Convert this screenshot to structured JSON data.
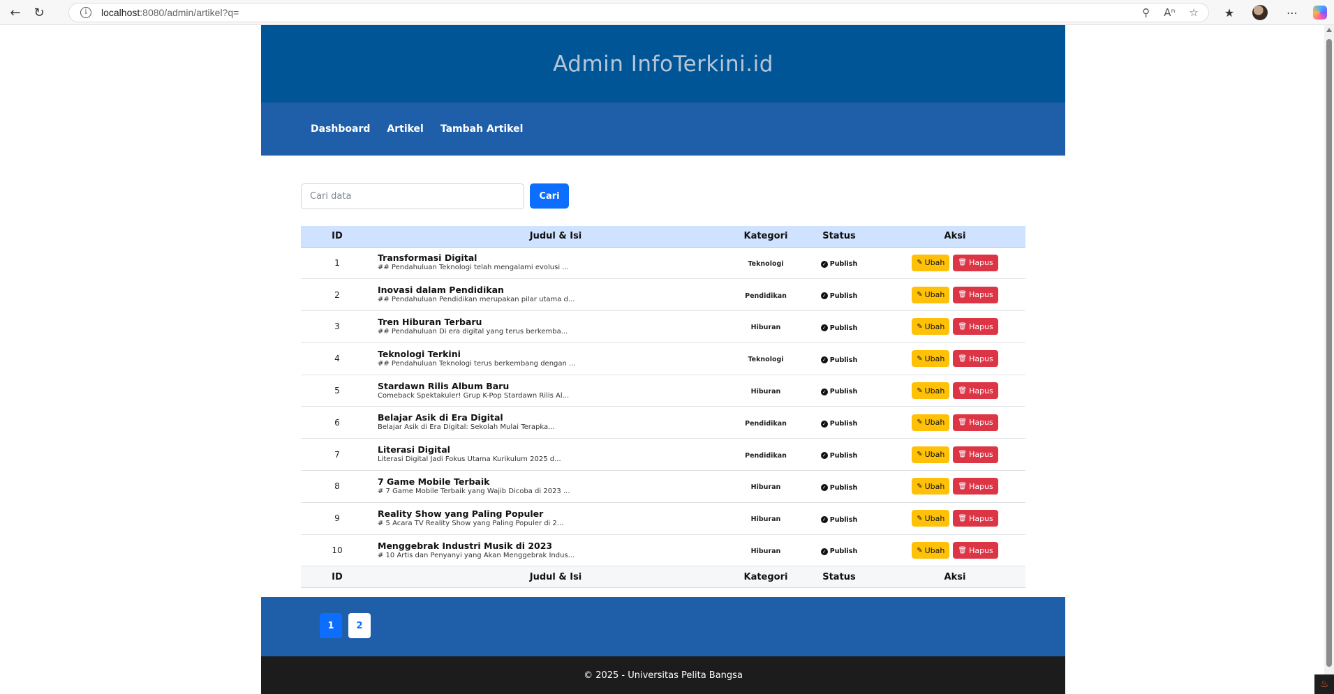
{
  "browser": {
    "url_host": "localhost",
    "url_rest": ":8080/admin/artikel?q="
  },
  "site": {
    "title": "Admin InfoTerkini.id"
  },
  "nav": {
    "items": [
      "Dashboard",
      "Artikel",
      "Tambah Artikel"
    ]
  },
  "search": {
    "placeholder": "Cari data",
    "button_label": "Cari"
  },
  "table": {
    "headers": [
      "ID",
      "Judul & Isi",
      "Kategori",
      "Status",
      "Aksi"
    ],
    "rows": [
      {
        "id": "1",
        "title": "Transformasi Digital",
        "excerpt": "## Pendahuluan Teknologi telah mengalami evolusi ...",
        "category": "Teknologi",
        "status": "Publish"
      },
      {
        "id": "2",
        "title": "Inovasi dalam Pendidikan",
        "excerpt": "## Pendahuluan Pendidikan merupakan pilar utama d...",
        "category": "Pendidikan",
        "status": "Publish"
      },
      {
        "id": "3",
        "title": "Tren Hiburan Terbaru",
        "excerpt": "## Pendahuluan Di era digital yang terus berkemba...",
        "category": "Hiburan",
        "status": "Publish"
      },
      {
        "id": "4",
        "title": "Teknologi Terkini",
        "excerpt": "## Pendahuluan Teknologi terus berkembang dengan ...",
        "category": "Teknologi",
        "status": "Publish"
      },
      {
        "id": "5",
        "title": "Stardawn Rilis Album Baru",
        "excerpt": "Comeback Spektakuler! Grup K-Pop Stardawn Rilis Al...",
        "category": "Hiburan",
        "status": "Publish"
      },
      {
        "id": "6",
        "title": "Belajar Asik di Era Digital",
        "excerpt": "Belajar Asik di Era Digital: Sekolah Mulai Terapka...",
        "category": "Pendidikan",
        "status": "Publish"
      },
      {
        "id": "7",
        "title": "Literasi Digital",
        "excerpt": "Literasi Digital Jadi Fokus Utama Kurikulum 2025 d...",
        "category": "Pendidikan",
        "status": "Publish"
      },
      {
        "id": "8",
        "title": "7 Game Mobile Terbaik",
        "excerpt": "# 7 Game Mobile Terbaik yang Wajib Dicoba di 2023 ...",
        "category": "Hiburan",
        "status": "Publish"
      },
      {
        "id": "9",
        "title": "Reality Show yang Paling Populer",
        "excerpt": "# 5 Acara TV Reality Show yang Paling Populer di 2...",
        "category": "Hiburan",
        "status": "Publish"
      },
      {
        "id": "10",
        "title": "Menggebrak Industri Musik di 2023",
        "excerpt": "# 10 Artis dan Penyanyi yang Akan Menggebrak Indus...",
        "category": "Hiburan",
        "status": "Publish"
      }
    ],
    "edit_label": "Ubah",
    "delete_label": "Hapus"
  },
  "pagination": {
    "pages": [
      "1",
      "2"
    ],
    "active": "1"
  },
  "footer": {
    "text": "© 2025 - Universitas Pelita Bangsa"
  },
  "colors": {
    "header_bg": "#005596",
    "nav_bg": "#1f5ea8",
    "primary": "#0d6efd",
    "warning": "#ffc107",
    "danger": "#dc3545",
    "footer_bg": "#1c1c1c"
  }
}
